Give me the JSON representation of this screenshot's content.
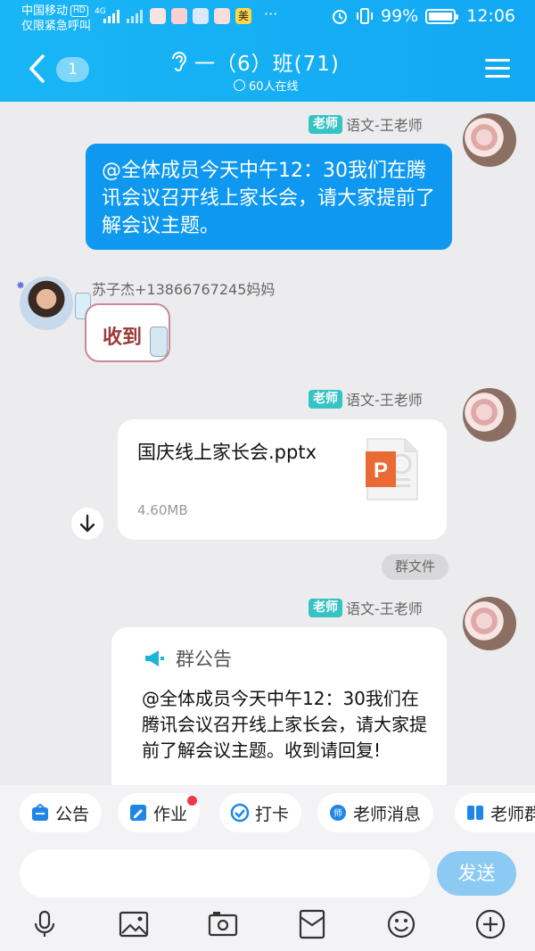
{
  "status_bar": {
    "carrier": "中国移动",
    "hd": "HD",
    "carrier_sub": "仅限紧急呼叫",
    "net": "4G",
    "more": "···",
    "battery": "99%",
    "time": "12:06"
  },
  "header": {
    "unread_badge": "1",
    "title": "一（6）班(71)",
    "online": "60人在线"
  },
  "messages": [
    {
      "tag": "老师",
      "sender": "语文-王老师",
      "text": "@全体成员今天中午12：30我们在腾讯会议召开线上家长会，请大家提前了解会议主题。"
    },
    {
      "sender": "苏子杰+13866767245妈妈",
      "sticker_text": "收到"
    },
    {
      "tag": "老师",
      "sender": "语文-王老师",
      "file_name": "国庆线上家长会.pptx",
      "file_size": "4.60MB",
      "file_label": "群文件"
    },
    {
      "tag": "老师",
      "sender": "语文-王老师",
      "notice_title": "群公告",
      "notice_text": "@全体成员今天中午12：30我们在腾讯会议召开线上家长会，请大家提前了解会议主题。收到请回复!"
    }
  ],
  "shortcuts": [
    "公告",
    "作业",
    "打卡",
    "老师消息",
    "老师群"
  ],
  "input": {
    "placeholder": "",
    "send_label": "发送"
  },
  "colors": {
    "header": "#12a8f3",
    "bubble": "#0e98ef",
    "tag": "#36c3c3",
    "send": "#8cc9f3"
  }
}
